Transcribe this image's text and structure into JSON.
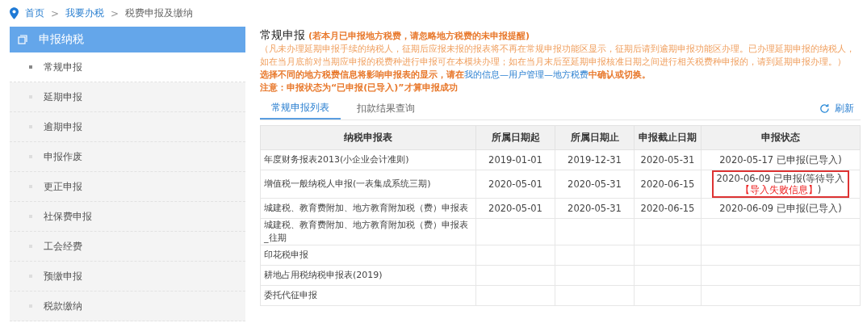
{
  "breadcrumb": [
    {
      "label": "首页",
      "link": true
    },
    {
      "label": "我要办税",
      "link": true
    },
    {
      "label": "税费申报及缴纳",
      "link": false
    }
  ],
  "breadcrumb_separator": ">",
  "sidebar": {
    "title": "申报纳税",
    "items": [
      {
        "label": "常规申报",
        "selected": true
      },
      {
        "label": "延期申报",
        "selected": false
      },
      {
        "label": "逾期申报",
        "selected": false
      },
      {
        "label": "申报作废",
        "selected": false
      },
      {
        "label": "更正申报",
        "selected": false
      },
      {
        "label": "社保费申报",
        "selected": false
      },
      {
        "label": "工会经费",
        "selected": false
      },
      {
        "label": "预缴申报",
        "selected": false
      },
      {
        "label": "税款缴纳",
        "selected": false
      }
    ]
  },
  "main": {
    "title": "常规申报",
    "title_note": "(若本月已申报地方税费，请忽略地方税费的未申报提醒)",
    "notice": "（凡未办理延期申报手续的纳税人，征期后应报未报的报表将不再在常规申报功能区显示，征期后请到逾期申报功能区办理。已办理延期申报的纳税人，如在当月底前对当期应申报的税费种进行申报可在本模块办理；如在当月末后至延期申报核准日期之间进行相关税费种申报的，请到延期申报办理。）",
    "switch_note_before": "选择不同的地方税费信息将影响申报表的显示，请在",
    "switch_note_link": "我的信息—用户管理—地方税费",
    "switch_note_after": "中确认或切换。",
    "warning": "注意：申报状态为“已申报(已导入)”才算申报成功",
    "tabs": [
      {
        "label": "常规申报列表",
        "selected": true
      },
      {
        "label": "扣款结果查询",
        "selected": false
      }
    ],
    "refresh": "刷新"
  },
  "table": {
    "columns": [
      "纳税申报表",
      "所属日期起",
      "所属日期止",
      "申报截止日期",
      "申报状态"
    ],
    "rows": [
      {
        "name": "年度财务报表2013(小企业会计准则)",
        "start": "2019-01-01",
        "end": "2019-12-31",
        "deadline": "2020-05-31",
        "status": "2020-05-17 已申报(已导入)"
      },
      {
        "name": "增值税一般纳税人申报(一表集成系统三期)",
        "start": "2020-05-01",
        "end": "2020-05-31",
        "deadline": "2020-06-15",
        "status": "2020-06-09 已申报(等待导入",
        "error_link": "【导入失败信息】",
        "status_end": ")"
      },
      {
        "name": "城建税、教育费附加、地方教育附加税（费）申报表",
        "start": "2020-05-01",
        "end": "2020-05-31",
        "deadline": "2020-06-15",
        "status": "2020-06-09 已申报(已导入)"
      },
      {
        "name": "城建税、教育费附加、地方教育附加税（费）申报表_往期"
      },
      {
        "name": "印花税申报"
      },
      {
        "name": "耕地占用税纳税申报表(2019)"
      },
      {
        "name": "委托代征申报"
      }
    ]
  }
}
